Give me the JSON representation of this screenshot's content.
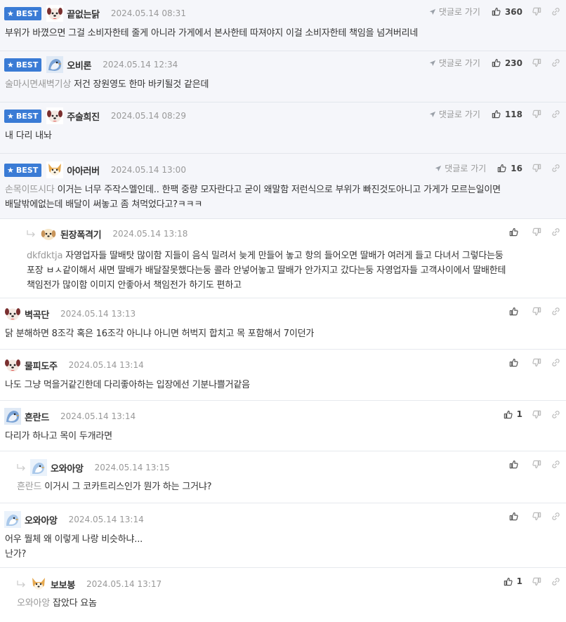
{
  "labels": {
    "best": "BEST",
    "goto": "댓글로 가기"
  },
  "comments": [
    {
      "nick": "끝없는닭",
      "date": "2024.05.14 08:31",
      "likes": "360",
      "text": "부위가 바꼈으면 그걸 소비자한테 줄게 아니라 가게에서 본사한테 따져야지 이걸 소비자한테 책임을 넘겨버리네",
      "avatar": "dog-avatar-red"
    },
    {
      "nick": "오비론",
      "date": "2024.05.14 12:34",
      "likes": "230",
      "mention": "술마시면새벽기상",
      "text": "저건 장원영도 한마 바키될것 같은데",
      "avatar": "bird-avatar-blue"
    },
    {
      "nick": "주술희진",
      "date": "2024.05.14 08:29",
      "likes": "118",
      "text": "내 다리 내놔",
      "avatar": "dog-avatar-red"
    },
    {
      "nick": "아아러버",
      "date": "2024.05.14 13:00",
      "likes": "16",
      "mention": "손목이뜨시다",
      "text": "이거는 너무 주작스멜인데.. 한팩 중량 모자란다고 굳이 왜말함 저런식으로 부위가 빠진것도아니고 가게가 모르는일이면",
      "text2": "배달밖에없는데 배달이 써놓고 좀 쳐먹었다고?ㅋㅋㅋ",
      "avatar": "dog-avatar-shiba"
    },
    {
      "nick": "된장폭격기",
      "date": "2024.05.14 13:18",
      "mention": "dkfdktja",
      "text": "자영업자들 딸배탓 많이함 지들이 음식 밀려서 늦게 만들어 놓고 항의 들어오면 딸배가 여러게 들고 다녀서 그렇다는둥",
      "text2": "포장 ㅂㅅ같이해서 새면 딸배가 배달잘못했다는둥 콜라 안넣어놓고 딸배가 안가지고 갔다는둥 자영업자들 고객사이에서 딸배한테",
      "text3": "책임전가 많이함 이미지 안좋아서 책임전가 하기도 편하고",
      "avatar": "dog-avatar-puppy"
    },
    {
      "nick": "벽곡단",
      "date": "2024.05.14 13:13",
      "text": "닭 분해하면 8조각 혹은 16조각 아니냐 아니면 허벅지 합치고 목 포함해서 7이던가",
      "avatar": "dog-avatar-red"
    },
    {
      "nick": "물피도주",
      "date": "2024.05.14 13:14",
      "text": "나도 그냥 먹을거같긴한데 다리좋아하는 입장에선 기분나쁠거같음",
      "avatar": "dog-avatar-red"
    },
    {
      "nick": "흔란드",
      "date": "2024.05.14 13:14",
      "likes": "1",
      "text": "다리가 하나고 목이 두개라면",
      "avatar": "bird-avatar-blue"
    },
    {
      "nick": "오와아앙",
      "date": "2024.05.14 13:15",
      "mention": "흔란드",
      "text": "이거시 그 코카트리스인가 뭔가 하는 그거냐?",
      "avatar": "bird-avatar-light"
    },
    {
      "nick": "오와아앙",
      "date": "2024.05.14 13:14",
      "text": "어우 뭘체 왜 이렇게 나랑 비슷하냐...",
      "text2": "난가?",
      "avatar": "bird-avatar-light"
    },
    {
      "nick": "보보봉",
      "date": "2024.05.14 13:17",
      "likes": "1",
      "mention": "오와아앙",
      "text": "잡았다 요놈",
      "avatar": "dog-avatar-shiba"
    }
  ]
}
